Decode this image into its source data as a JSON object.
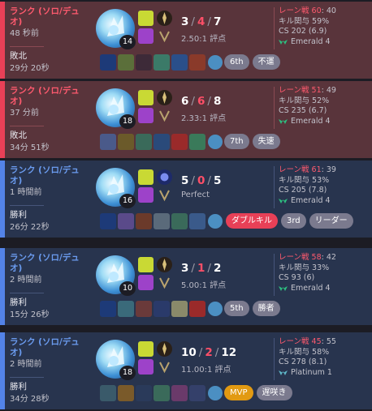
{
  "colors": {
    "loss_bg": "#59343b",
    "loss_accent": "#e84057",
    "win_bg": "#28344e",
    "win_accent": "#5383e8",
    "death_red": "#ff4f68",
    "lane_red": "#ff5a6e",
    "mvp_gold": "#e29a12"
  },
  "matches": [
    {
      "queue": "ランク (ソロ/デュオ)",
      "time_ago": "48 秒前",
      "result": "敗北",
      "duration": "29分 20秒",
      "level": "14",
      "kills": "3",
      "deaths": "4",
      "assists": "7",
      "ratio": "2.50:1 評点",
      "lane_label": "レーン戦 60",
      "lane_score": ": 40",
      "kill_part": "キル関与 59%",
      "cs": "CS 202 (6.9)",
      "rank": "Emerald 4",
      "rank_icon": "emerald-icon",
      "tags": [
        {
          "label": "6th",
          "style": "gray"
        },
        {
          "label": "不運",
          "style": "gray"
        }
      ]
    },
    {
      "queue": "ランク (ソロ/デュオ)",
      "time_ago": "37 分前",
      "result": "敗北",
      "duration": "34分 51秒",
      "level": "18",
      "kills": "6",
      "deaths": "6",
      "assists": "8",
      "ratio": "2.33:1 評点",
      "lane_label": "レーン戦 51",
      "lane_score": ": 49",
      "kill_part": "キル関与 52%",
      "cs": "CS 235 (6.7)",
      "rank": "Emerald 4",
      "rank_icon": "emerald-icon",
      "tags": [
        {
          "label": "7th",
          "style": "gray"
        },
        {
          "label": "失速",
          "style": "gray"
        }
      ]
    },
    {
      "queue": "ランク (ソロ/デュオ)",
      "time_ago": "1 時間前",
      "result": "勝利",
      "duration": "26分 22秒",
      "level": "16",
      "kills": "5",
      "deaths": "0",
      "assists": "5",
      "ratio": "Perfect",
      "lane_label": "レーン戦 61",
      "lane_score": ": 39",
      "kill_part": "キル関与 53%",
      "cs": "CS 205 (7.8)",
      "rank": "Emerald 4",
      "rank_icon": "emerald-icon",
      "tags": [
        {
          "label": "ダブルキル",
          "style": "red"
        },
        {
          "label": "3rd",
          "style": "gray"
        },
        {
          "label": "リーダー",
          "style": "gray"
        }
      ]
    },
    {
      "queue": "ランク (ソロ/デュオ)",
      "time_ago": "2 時間前",
      "result": "勝利",
      "duration": "15分 26秒",
      "level": "10",
      "kills": "3",
      "deaths": "1",
      "assists": "2",
      "ratio": "5.00:1 評点",
      "lane_label": "レーン戦 58",
      "lane_score": ": 42",
      "kill_part": "キル関与 33%",
      "cs": "CS 93 (6)",
      "rank": "Emerald 4",
      "rank_icon": "emerald-icon",
      "tags": [
        {
          "label": "5th",
          "style": "gray"
        },
        {
          "label": "勝者",
          "style": "gray"
        }
      ]
    },
    {
      "queue": "ランク (ソロ/デュオ)",
      "time_ago": "2 時間前",
      "result": "勝利",
      "duration": "34分 28秒",
      "level": "18",
      "kills": "10",
      "deaths": "2",
      "assists": "12",
      "ratio": "11.00:1 評点",
      "lane_label": "レーン戦 45",
      "lane_score": ": 55",
      "kill_part": "キル関与 58%",
      "cs": "CS 278 (8.1)",
      "rank": "Platinum 1",
      "rank_icon": "platinum-icon",
      "tags": [
        {
          "label": "MVP",
          "style": "gold"
        },
        {
          "label": "遅咲き",
          "style": "gray"
        }
      ]
    }
  ]
}
